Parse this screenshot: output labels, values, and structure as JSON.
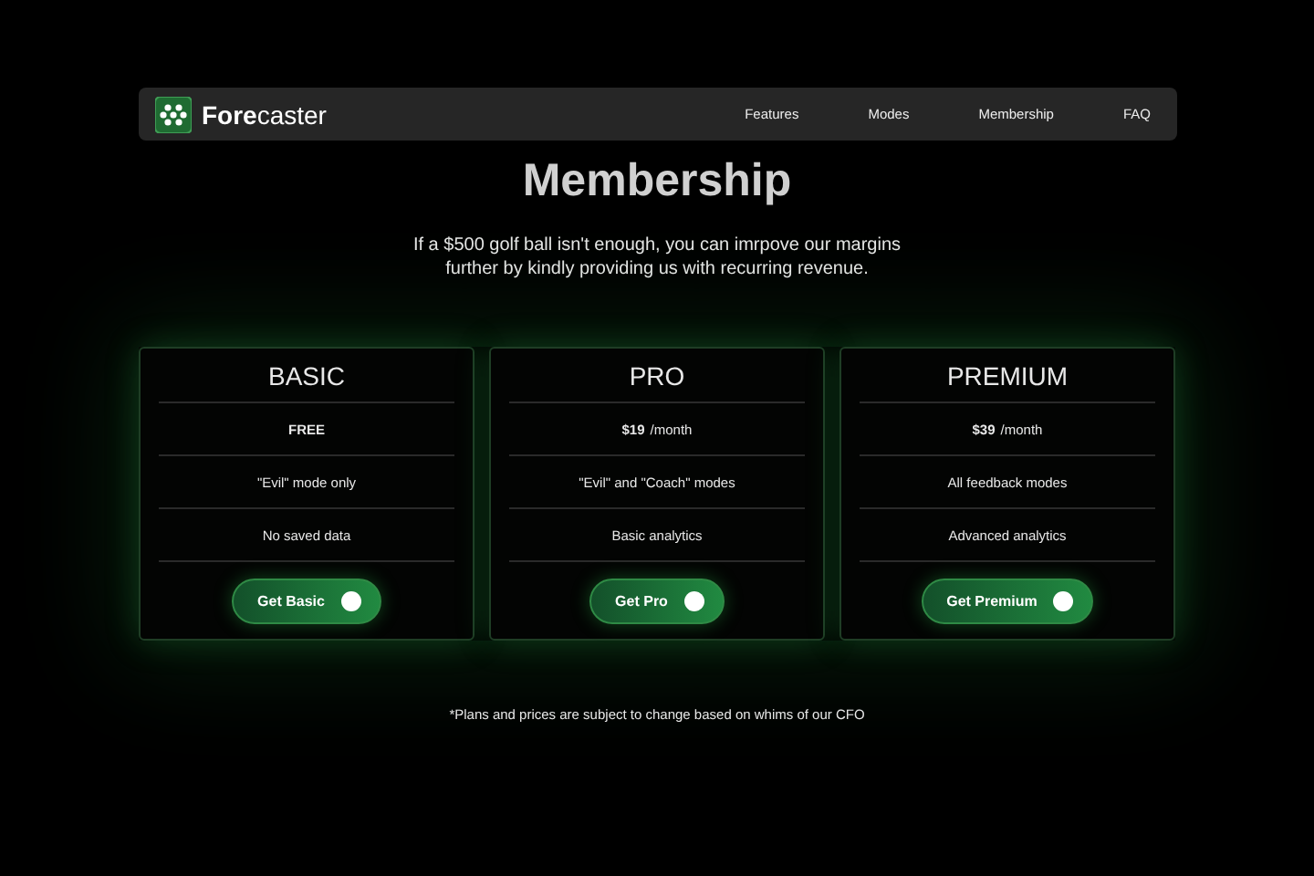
{
  "nav": {
    "brand": "**Fore**caster",
    "links": [
      "Features",
      "Modes",
      "Membership",
      "FAQ"
    ]
  },
  "title": "Membership",
  "subtitle": "If a $500 golf ball isn't enough, you can imrpove our margins further by kindly providing us with recurring revenue.",
  "plans": [
    {
      "name": "BASIC",
      "amount": "FREE",
      "features": [
        "\"Evil\" mode only",
        "No saved data"
      ],
      "button": "Get Basic"
    },
    {
      "name": "PRO",
      "amount": "$19",
      "period": "/month",
      "features": [
        "\"Evil\" and \"Coach\" modes",
        "Basic analytics"
      ],
      "button": "Get Pro"
    },
    {
      "name": "PREMIUM",
      "amount": "$39",
      "period": "/month",
      "features": [
        "All feedback modes",
        "Advanced analytics"
      ],
      "button": "Get Premium"
    }
  ],
  "footnote": "*Plans and prices are subject to change based on whims of our CFO"
}
